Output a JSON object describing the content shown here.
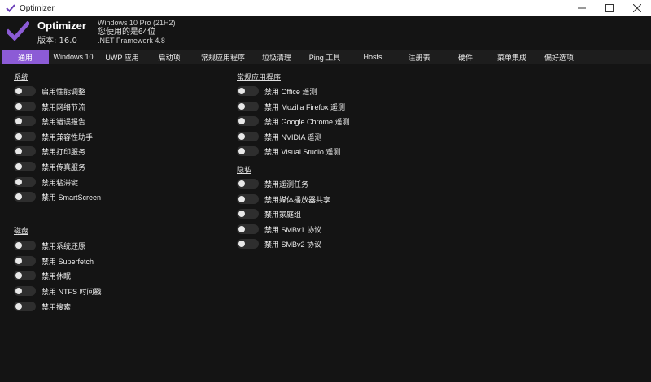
{
  "window": {
    "title": "Optimizer"
  },
  "header": {
    "app_name": "Optimizer",
    "version": "版本: 16.0",
    "os": "Windows 10 Pro (21H2)",
    "arch": "您使用的是64位",
    "framework": ".NET Framework 4.8"
  },
  "colors": {
    "accent": "#8c5bd6",
    "background": "#141414"
  },
  "tabs": [
    {
      "label": "通用"
    },
    {
      "label": "Windows 10"
    },
    {
      "label": "UWP 应用"
    },
    {
      "label": "启动项"
    },
    {
      "label": "常规应用程序"
    },
    {
      "label": "垃圾清理"
    },
    {
      "label": "Ping 工具"
    },
    {
      "label": "Hosts"
    },
    {
      "label": "注册表"
    },
    {
      "label": "硬件"
    },
    {
      "label": "菜单集成"
    },
    {
      "label": "偏好选项"
    }
  ],
  "sections": {
    "system": {
      "title": "系统",
      "items": [
        "启用性能调整",
        "禁用网络节流",
        "禁用错误报告",
        "禁用兼容性助手",
        "禁用打印服务",
        "禁用传真服务",
        "禁用粘滞键",
        "禁用 SmartScreen"
      ]
    },
    "disk": {
      "title": "磁盘",
      "items": [
        "禁用系统还原",
        "禁用 Superfetch",
        "禁用休眠",
        "禁用 NTFS 时间戳",
        "禁用搜索"
      ]
    },
    "common_apps": {
      "title": "常规应用程序",
      "items": [
        "禁用 Office 遥测",
        "禁用 Mozilla Firefox 遥测",
        "禁用 Google Chrome 遥测",
        "禁用 NVIDIA 遥测",
        "禁用 Visual Studio 遥测"
      ]
    },
    "privacy": {
      "title": "隐私",
      "items": [
        "禁用遥测任务",
        "禁用媒体播放器共享",
        "禁用家庭组",
        "禁用 SMBv1 协议",
        "禁用 SMBv2 协议"
      ]
    }
  }
}
